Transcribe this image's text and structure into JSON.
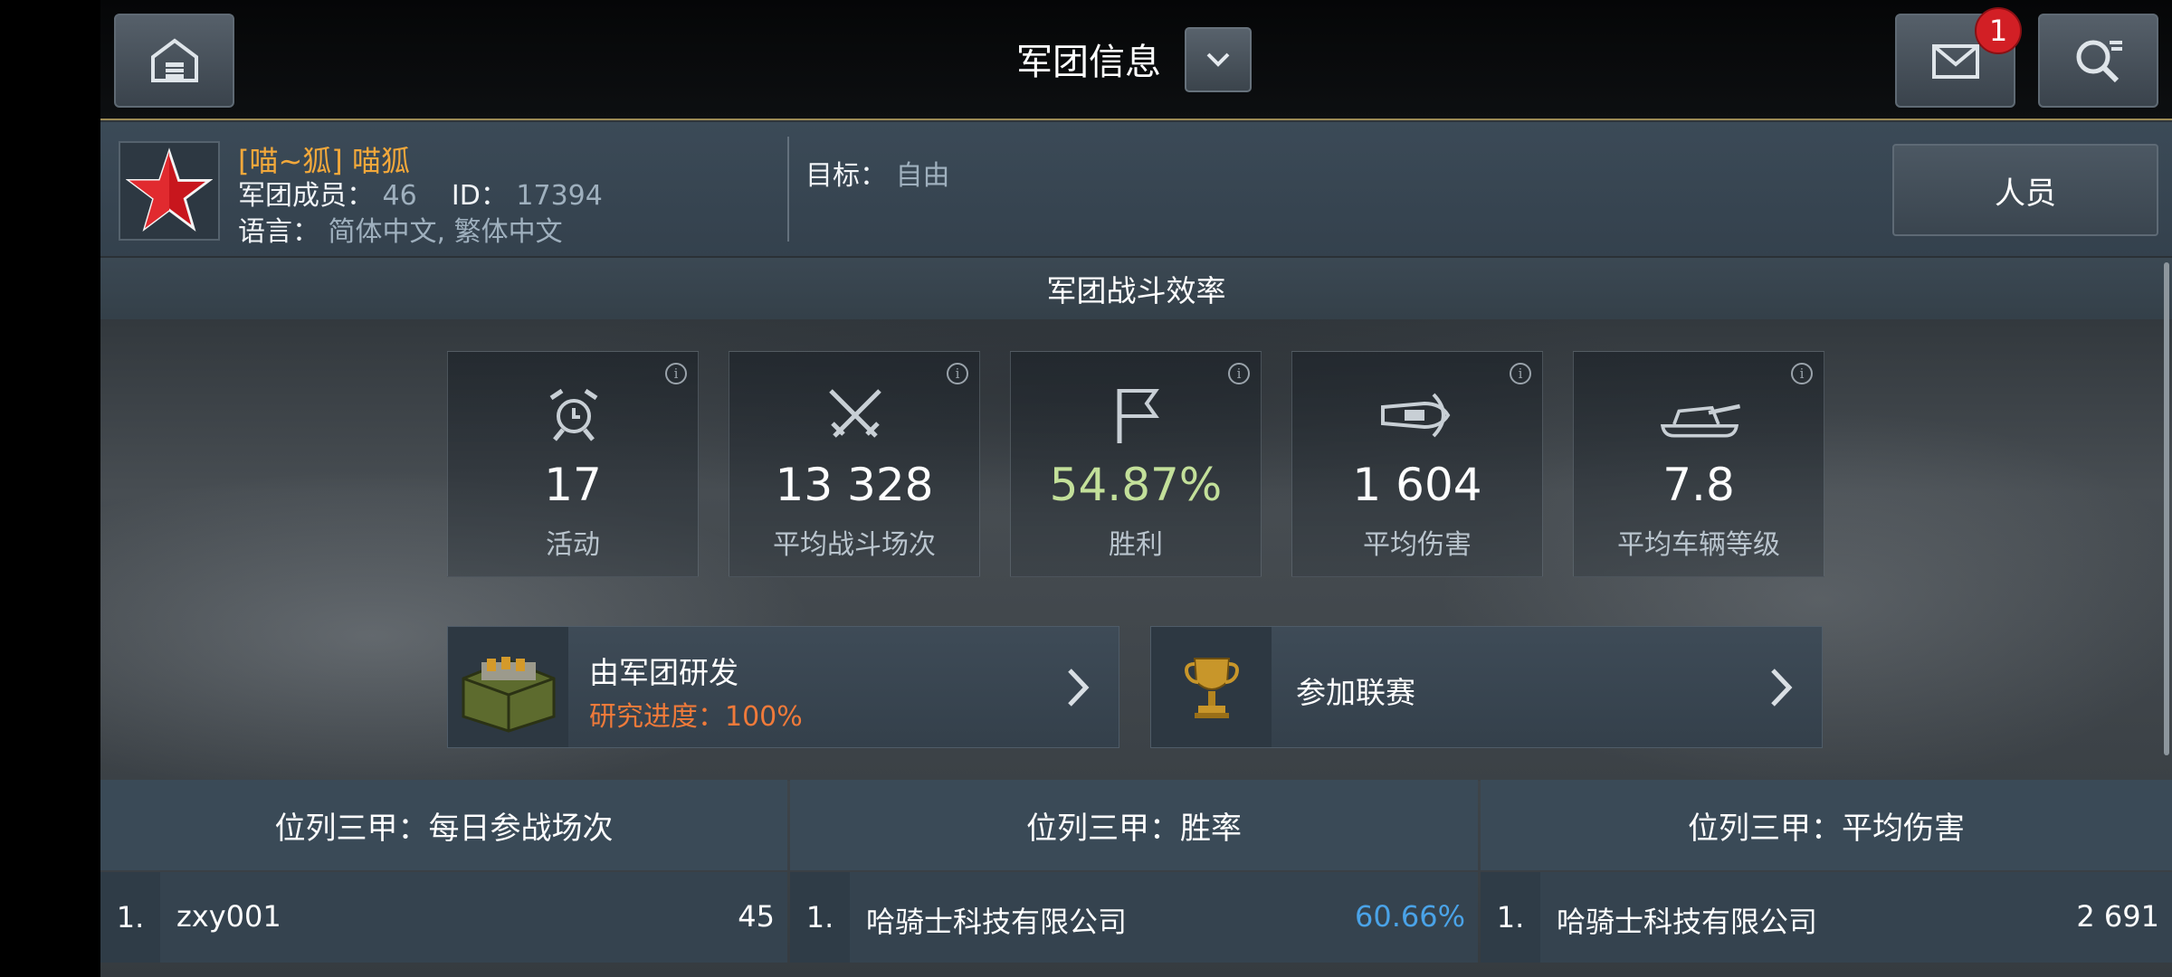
{
  "header": {
    "title": "军团信息",
    "mail_badge_count": "1"
  },
  "clan": {
    "name": "[喵~狐] 喵狐",
    "members_label": "军团成员：",
    "members_value": "46",
    "id_label": "ID：",
    "id_value": "17394",
    "language_label": "语言：",
    "language_value": "简体中文, 繁体中文",
    "goal_label": "目标：",
    "goal_value": "自由",
    "people_button": "人员"
  },
  "efficiency": {
    "section_title": "军团战斗效率",
    "stats": [
      {
        "value": "17",
        "label": "活动",
        "icon": "alarm-clock-icon"
      },
      {
        "value": "13 328",
        "label": "平均战斗场次",
        "icon": "crossed-swords-icon"
      },
      {
        "value": "54.87%",
        "label": "胜利",
        "icon": "flag-icon"
      },
      {
        "value": "1 604",
        "label": "平均伤害",
        "icon": "shell-icon"
      },
      {
        "value": "7.8",
        "label": "平均车辆等级",
        "icon": "tank-icon"
      }
    ]
  },
  "actions": {
    "research_title": "由军团研发",
    "research_progress": "研究进度：100%",
    "league_title": "参加联赛"
  },
  "top3": {
    "columns": [
      {
        "title": "位列三甲：每日参战场次",
        "rank": "1.",
        "name": "zxy001",
        "value": "45"
      },
      {
        "title": "位列三甲：胜率",
        "rank": "1.",
        "name": "哈骑士科技有限公司",
        "value": "60.66%"
      },
      {
        "title": "位列三甲：平均伤害",
        "rank": "1.",
        "name": "哈骑士科技有限公司",
        "value": "2 691"
      }
    ]
  },
  "colors": {
    "clan_name": "#f2a83b",
    "win_rate": "#c3e09a",
    "research_progress": "#f07a3a",
    "badge": "#d21f25",
    "win_rate_top": "#4aa3e8"
  }
}
